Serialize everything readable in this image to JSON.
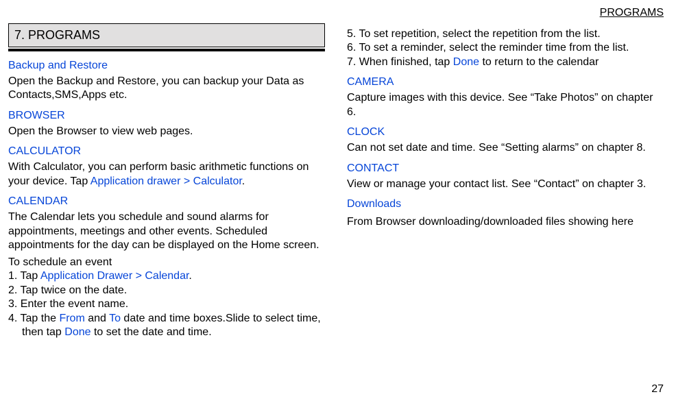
{
  "header": {
    "running_title": "PROGRAMS"
  },
  "chapter": {
    "title": "7. PROGRAMS"
  },
  "left": {
    "backup": {
      "head": "Backup and Restore",
      "body": "Open the Backup and Restore, you can backup your Data as Contacts,SMS,Apps etc."
    },
    "browser": {
      "head": "BROWSER",
      "body": "Open the Browser to view web pages."
    },
    "calculator": {
      "head": "CALCULATOR",
      "body1": "With Calculator, you can perform basic arithmetic functions on your device. Tap ",
      "link": "Application drawer > Calculator",
      "body2": "."
    },
    "calendar": {
      "head": "CALENDAR",
      "body": "The Calendar lets you schedule and sound alarms for appointments, meetings and other events. Scheduled appointments for the day can be displayed on the Home screen.",
      "sub": "To schedule an event",
      "s1a": "1. Tap ",
      "s1link": "Application Drawer > Calendar",
      "s1b": ".",
      "s2": "2. Tap twice on the date.",
      "s3": "3. Enter the event name.",
      "s4a": "4. Tap the ",
      "s4from": "From",
      "s4mid": " and ",
      "s4to": "To",
      "s4b": " date and time boxes.Slide to select time, then tap ",
      "s4done": "Done",
      "s4c": " to set the date and time."
    }
  },
  "right": {
    "cal_cont": {
      "s5": "5. To set repetition, select the repetition from the list.",
      "s6": "6. To set a reminder, select the reminder time from the list.",
      "s7a": "7. When finished, tap ",
      "s7done": "Done",
      "s7b": " to return to the calendar"
    },
    "camera": {
      "head": "CAMERA",
      "body": "Capture images with this device. See “Take Photos” on chapter 6."
    },
    "clock": {
      "head": "CLOCK",
      "body": "Can not set date and time. See “Setting alarms” on chapter 8."
    },
    "contact": {
      "head": "CONTACT",
      "body": "View or manage your contact list. See “Contact” on chapter 3."
    },
    "downloads": {
      "head": "Downloads",
      "body": "From Browser downloading/downloaded files showing here"
    }
  },
  "footer": {
    "page_number": "27"
  }
}
